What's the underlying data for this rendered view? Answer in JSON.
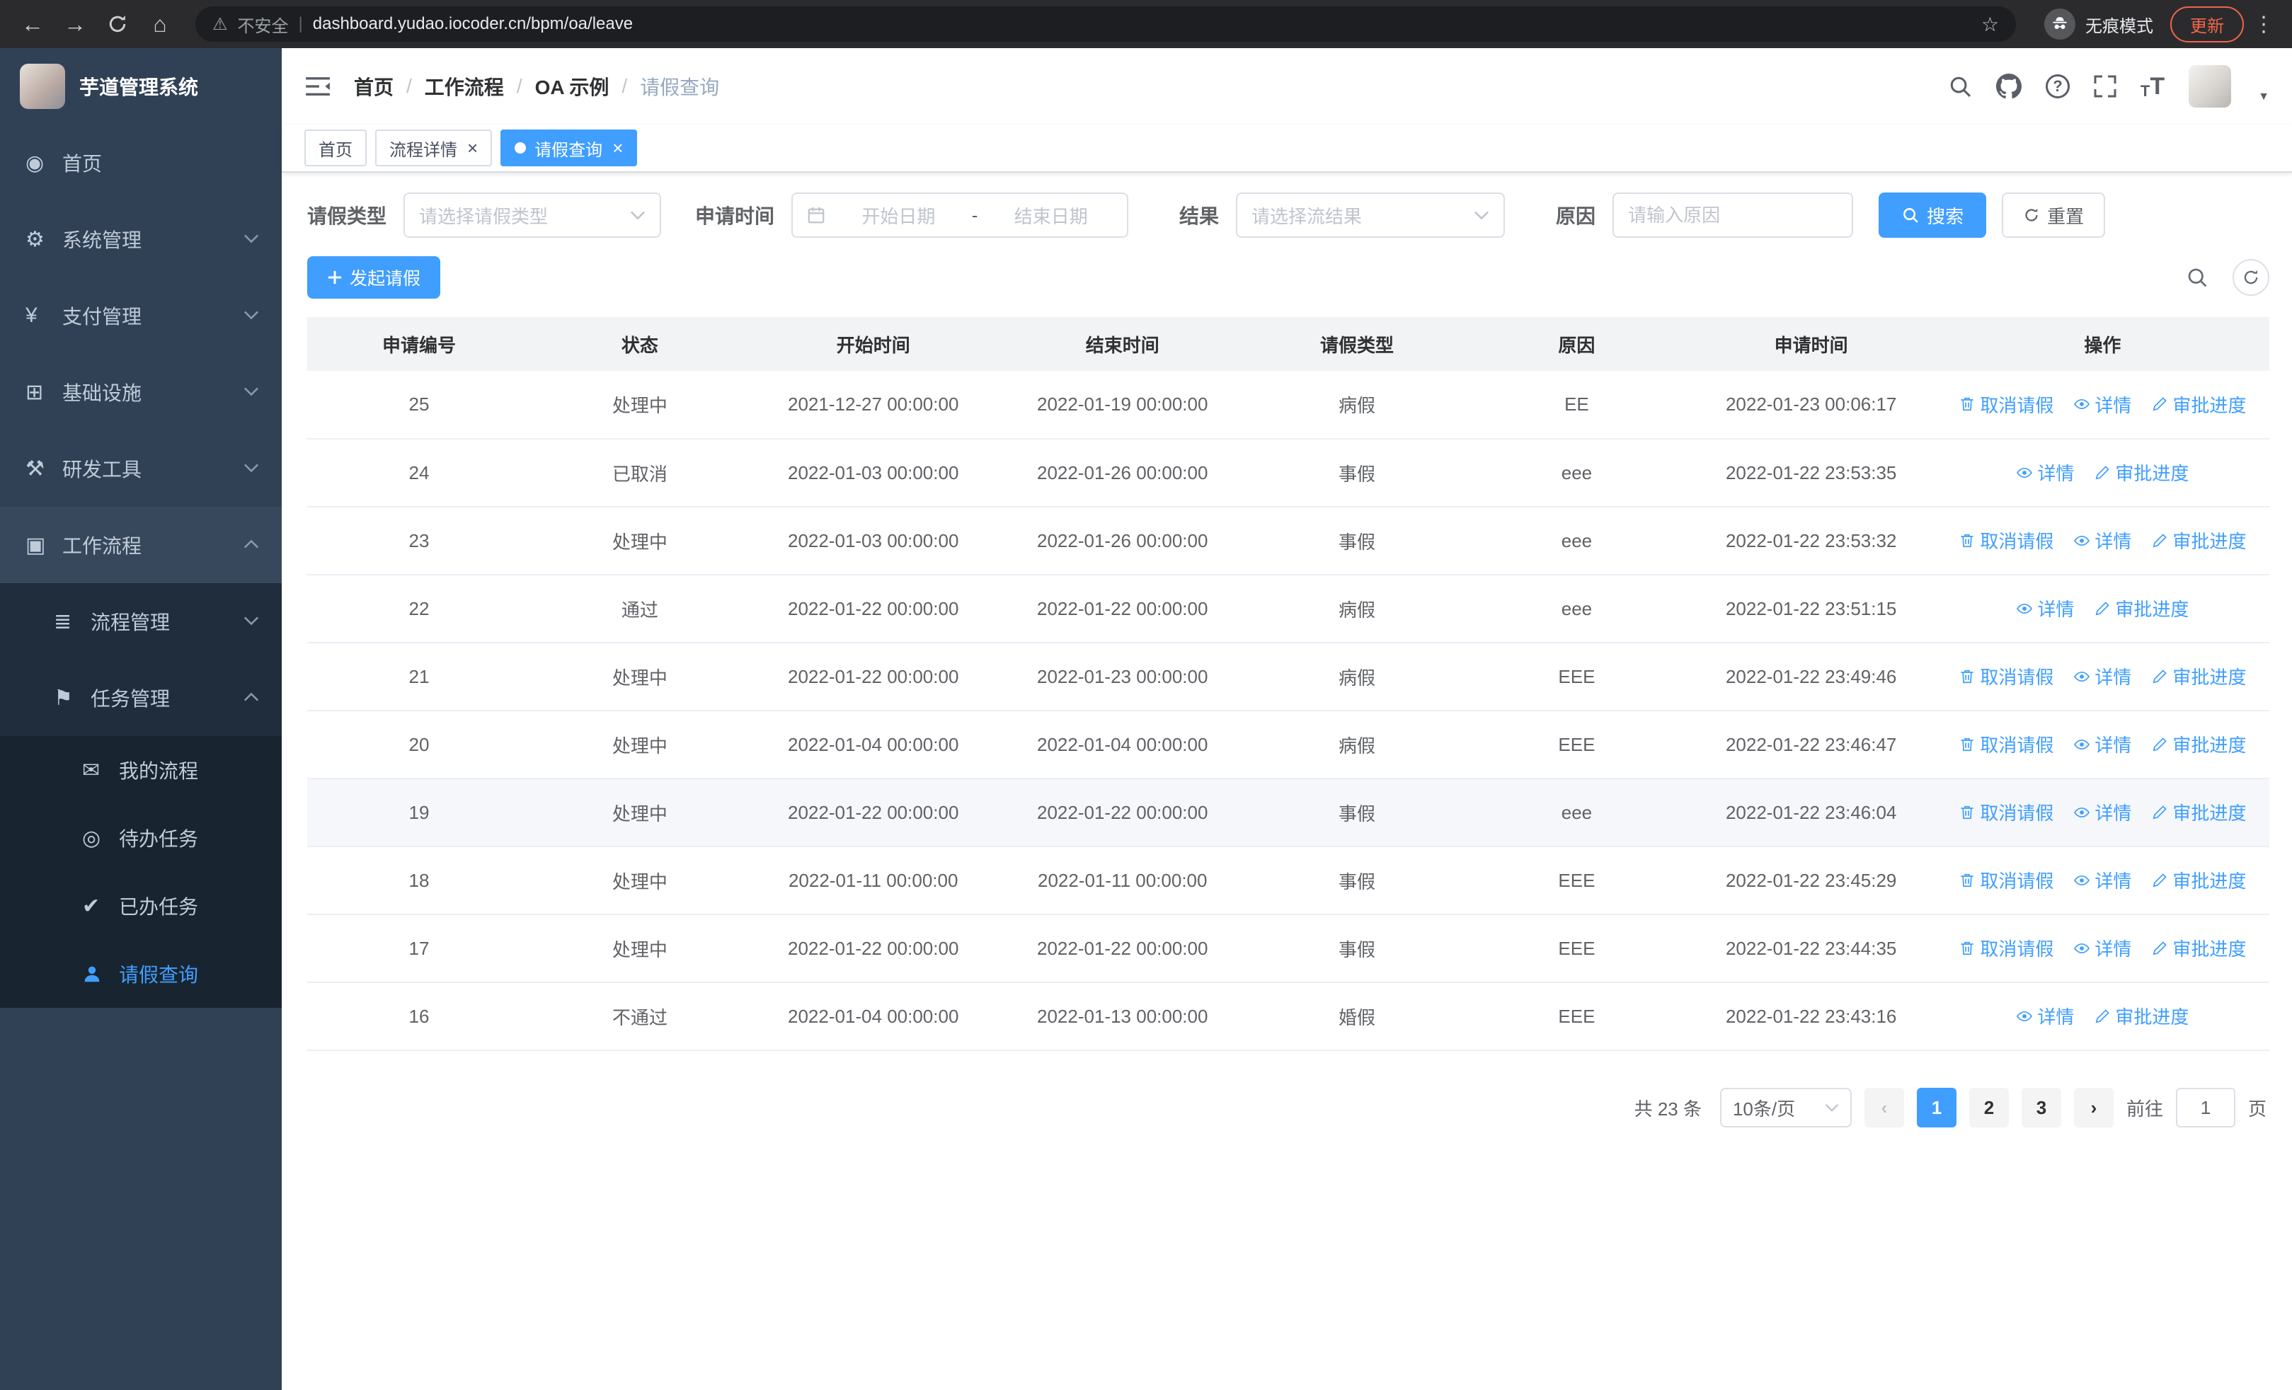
{
  "colors": {
    "accent": "#409eff",
    "sidebar_bg": "#304156",
    "submenu_bg": "#1f2d3d",
    "update_chip": "#f06548"
  },
  "icons": {
    "dashboard": "◉",
    "gear": "⚙",
    "payment": "¥",
    "infra": "⊞",
    "devtools": "⚒",
    "workflow": "▣",
    "process": "≣",
    "task": "⚑",
    "my_process": "✉",
    "todo": "◎",
    "done": "✔",
    "warn_triangle": "⚠",
    "star": "☆",
    "back": "←",
    "forward": "→",
    "home": "⌂",
    "menu_dots": "⋮",
    "avatar_caret": "▼",
    "prev_arrow": "‹",
    "next_arrow": "›"
  },
  "browser": {
    "security_chip": "不安全",
    "url": "dashboard.yudao.iocoder.cn/bpm/oa/leave",
    "incognito_label": "无痕模式",
    "update_label": "更新"
  },
  "sidebar": {
    "title": "芋道管理系统",
    "items": [
      {
        "label": "首页"
      },
      {
        "label": "系统管理"
      },
      {
        "label": "支付管理"
      },
      {
        "label": "基础设施"
      },
      {
        "label": "研发工具"
      },
      {
        "label": "工作流程"
      }
    ],
    "workflow_children": [
      {
        "label": "流程管理"
      },
      {
        "label": "任务管理"
      }
    ],
    "task_children": [
      {
        "label": "我的流程"
      },
      {
        "label": "待办任务"
      },
      {
        "label": "已办任务"
      },
      {
        "label": "请假查询"
      }
    ]
  },
  "header": {
    "breadcrumb": [
      "首页",
      "工作流程",
      "OA 示例",
      "请假查询"
    ]
  },
  "tabs": [
    {
      "label": "首页"
    },
    {
      "label": "流程详情",
      "close": "×"
    },
    {
      "label": "请假查询",
      "close": "×"
    }
  ],
  "filters": {
    "leave_type_label": "请假类型",
    "leave_type_placeholder": "请选择请假类型",
    "apply_time_label": "申请时间",
    "start_date_placeholder": "开始日期",
    "range_separator": "-",
    "end_date_placeholder": "结束日期",
    "result_label": "结果",
    "result_placeholder": "请选择流结果",
    "reason_label": "原因",
    "reason_placeholder": "请输入原因",
    "search_button": "搜索",
    "reset_button": "重置"
  },
  "toolbar": {
    "create_button": "发起请假"
  },
  "table": {
    "columns": [
      "申请编号",
      "状态",
      "开始时间",
      "结束时间",
      "请假类型",
      "原因",
      "申请时间",
      "操作"
    ],
    "rows": [
      {
        "id": "25",
        "status": "处理中",
        "start": "2021-12-27 00:00:00",
        "end": "2022-01-19 00:00:00",
        "type": "病假",
        "reason": "EE",
        "applied": "2022-01-23 00:06:17",
        "actions": [
          {
            "key": "cancel",
            "label": "取消请假"
          },
          {
            "key": "detail",
            "label": "详情"
          },
          {
            "key": "progress",
            "label": "审批进度"
          }
        ]
      },
      {
        "id": "24",
        "status": "已取消",
        "start": "2022-01-03 00:00:00",
        "end": "2022-01-26 00:00:00",
        "type": "事假",
        "reason": "eee",
        "applied": "2022-01-22 23:53:35",
        "actions": [
          {
            "key": "detail",
            "label": "详情"
          },
          {
            "key": "progress",
            "label": "审批进度"
          }
        ]
      },
      {
        "id": "23",
        "status": "处理中",
        "start": "2022-01-03 00:00:00",
        "end": "2022-01-26 00:00:00",
        "type": "事假",
        "reason": "eee",
        "applied": "2022-01-22 23:53:32",
        "actions": [
          {
            "key": "cancel",
            "label": "取消请假"
          },
          {
            "key": "detail",
            "label": "详情"
          },
          {
            "key": "progress",
            "label": "审批进度"
          }
        ]
      },
      {
        "id": "22",
        "status": "通过",
        "start": "2022-01-22 00:00:00",
        "end": "2022-01-22 00:00:00",
        "type": "病假",
        "reason": "eee",
        "applied": "2022-01-22 23:51:15",
        "actions": [
          {
            "key": "detail",
            "label": "详情"
          },
          {
            "key": "progress",
            "label": "审批进度"
          }
        ]
      },
      {
        "id": "21",
        "status": "处理中",
        "start": "2022-01-22 00:00:00",
        "end": "2022-01-23 00:00:00",
        "type": "病假",
        "reason": "EEE",
        "applied": "2022-01-22 23:49:46",
        "actions": [
          {
            "key": "cancel",
            "label": "取消请假"
          },
          {
            "key": "detail",
            "label": "详情"
          },
          {
            "key": "progress",
            "label": "审批进度"
          }
        ]
      },
      {
        "id": "20",
        "status": "处理中",
        "start": "2022-01-04 00:00:00",
        "end": "2022-01-04 00:00:00",
        "type": "病假",
        "reason": "EEE",
        "applied": "2022-01-22 23:46:47",
        "actions": [
          {
            "key": "cancel",
            "label": "取消请假"
          },
          {
            "key": "detail",
            "label": "详情"
          },
          {
            "key": "progress",
            "label": "审批进度"
          }
        ]
      },
      {
        "id": "19",
        "status": "处理中",
        "start": "2022-01-22 00:00:00",
        "end": "2022-01-22 00:00:00",
        "type": "事假",
        "reason": "eee",
        "applied": "2022-01-22 23:46:04",
        "highlighted": true,
        "actions": [
          {
            "key": "cancel",
            "label": "取消请假"
          },
          {
            "key": "detail",
            "label": "详情"
          },
          {
            "key": "progress",
            "label": "审批进度"
          }
        ]
      },
      {
        "id": "18",
        "status": "处理中",
        "start": "2022-01-11 00:00:00",
        "end": "2022-01-11 00:00:00",
        "type": "事假",
        "reason": "EEE",
        "applied": "2022-01-22 23:45:29",
        "actions": [
          {
            "key": "cancel",
            "label": "取消请假"
          },
          {
            "key": "detail",
            "label": "详情"
          },
          {
            "key": "progress",
            "label": "审批进度"
          }
        ]
      },
      {
        "id": "17",
        "status": "处理中",
        "start": "2022-01-22 00:00:00",
        "end": "2022-01-22 00:00:00",
        "type": "事假",
        "reason": "EEE",
        "applied": "2022-01-22 23:44:35",
        "actions": [
          {
            "key": "cancel",
            "label": "取消请假"
          },
          {
            "key": "detail",
            "label": "详情"
          },
          {
            "key": "progress",
            "label": "审批进度"
          }
        ]
      },
      {
        "id": "16",
        "status": "不通过",
        "start": "2022-01-04 00:00:00",
        "end": "2022-01-13 00:00:00",
        "type": "婚假",
        "reason": "EEE",
        "applied": "2022-01-22 23:43:16",
        "actions": [
          {
            "key": "detail",
            "label": "详情"
          },
          {
            "key": "progress",
            "label": "审批进度"
          }
        ]
      }
    ]
  },
  "pagination": {
    "total": "共 23 条",
    "page_size": "10条/页",
    "pages": [
      "1",
      "2",
      "3"
    ],
    "goto_label": "前往",
    "goto_value": "1",
    "page_unit": "页"
  }
}
